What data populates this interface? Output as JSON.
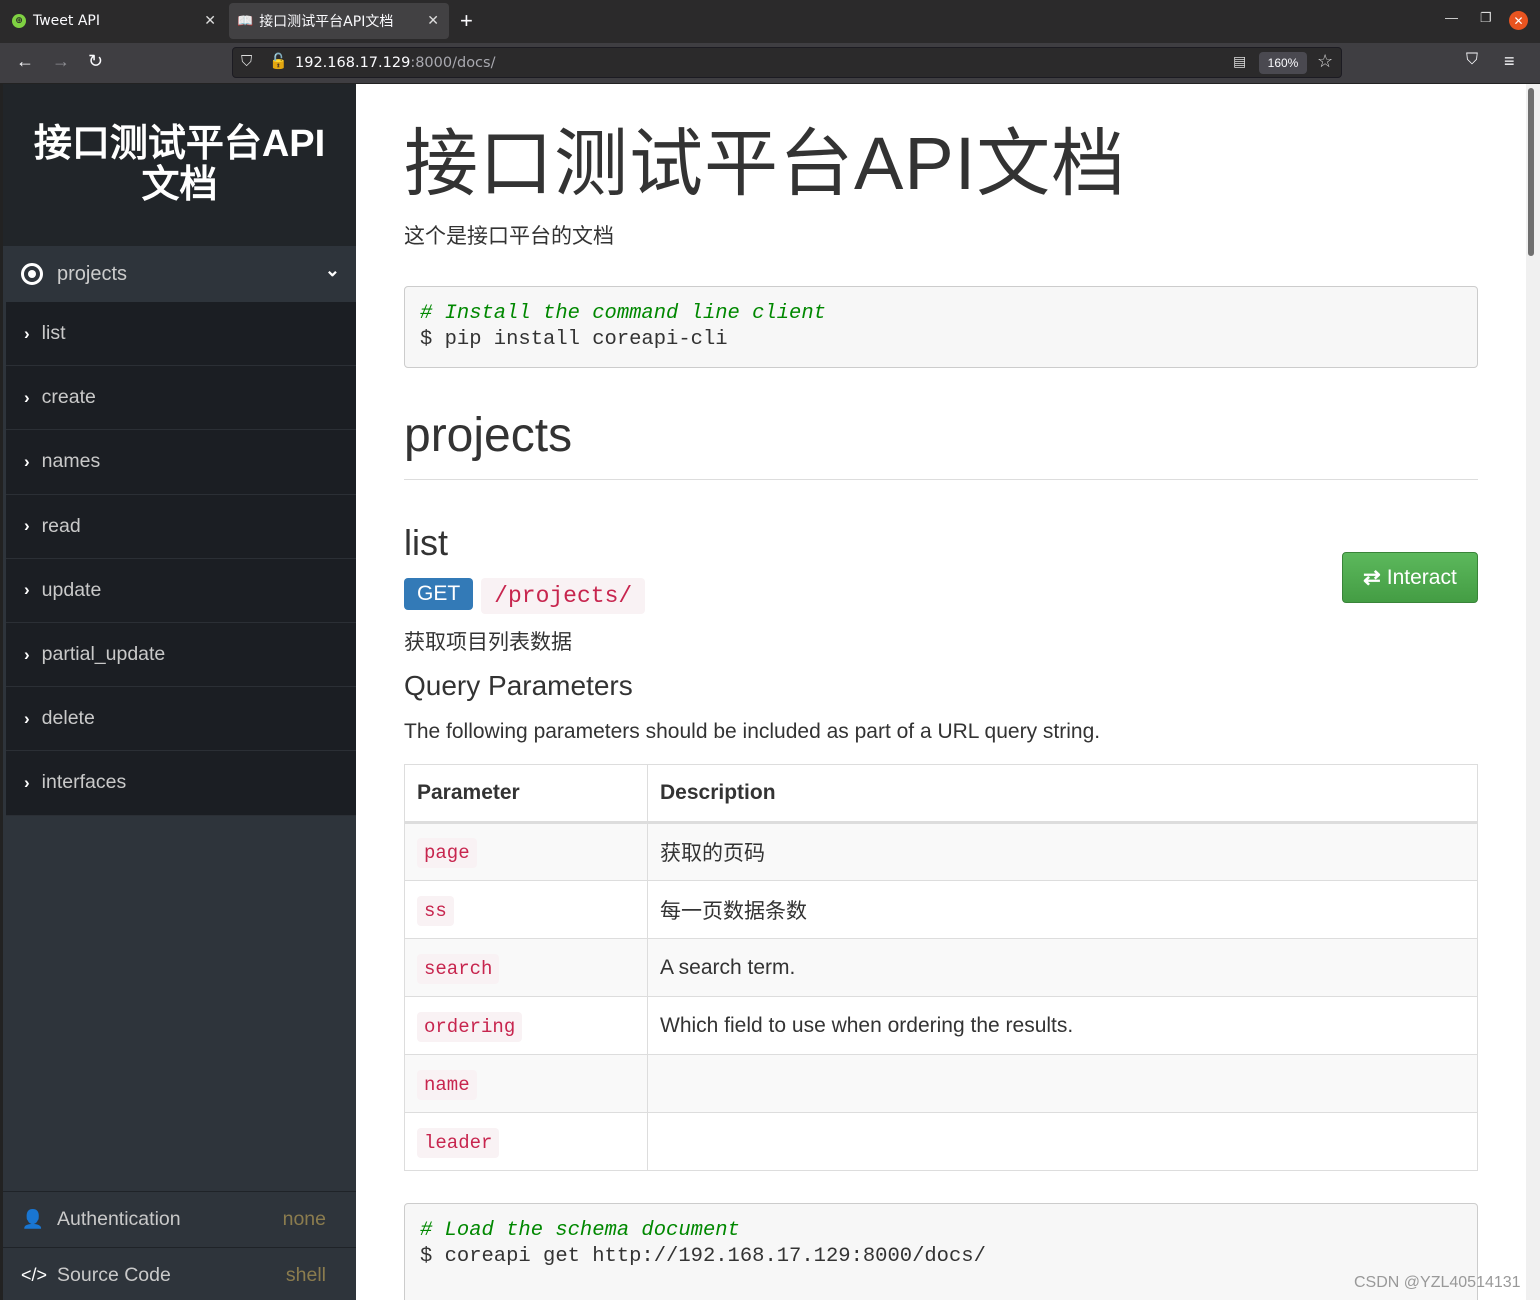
{
  "browser": {
    "tabs": [
      {
        "title": "Tweet API",
        "icon": "globe-icon",
        "active": false
      },
      {
        "title": "接口测试平台API文档",
        "icon": "reader-book-icon",
        "active": true
      }
    ],
    "url_host": "192.168.17.129",
    "url_rest": ":8000/docs/",
    "zoom_level": "160%"
  },
  "sidebar": {
    "title": "接口测试平台API文档",
    "group": {
      "label": "projects",
      "icon": "target-icon",
      "expanded": true
    },
    "items": [
      {
        "label": "list"
      },
      {
        "label": "create"
      },
      {
        "label": "names"
      },
      {
        "label": "read"
      },
      {
        "label": "update"
      },
      {
        "label": "partial_update"
      },
      {
        "label": "delete"
      },
      {
        "label": "interfaces"
      }
    ],
    "footer": [
      {
        "label": "Authentication",
        "value": "none",
        "icon": "user-icon"
      },
      {
        "label": "Source Code",
        "value": "shell",
        "icon": "code-icon"
      }
    ]
  },
  "main": {
    "title": "接口测试平台API文档",
    "subtitle": "这个是接口平台的文档",
    "install_code": {
      "comment": "# Install the command line client",
      "command": "$ pip install coreapi-cli"
    },
    "section_title": "projects",
    "endpoint": {
      "name": "list",
      "method": "GET",
      "path": "/projects/",
      "interact_label": "Interact",
      "description": "获取项目列表数据",
      "query_title": "Query Parameters",
      "query_desc": "The following parameters should be included as part of a URL query string.",
      "table": {
        "headers": [
          "Parameter",
          "Description"
        ],
        "rows": [
          {
            "param": "page",
            "desc": "获取的页码"
          },
          {
            "param": "ss",
            "desc": "每一页数据条数"
          },
          {
            "param": "search",
            "desc": "A search term."
          },
          {
            "param": "ordering",
            "desc": "Which field to use when ordering the results."
          },
          {
            "param": "name",
            "desc": ""
          },
          {
            "param": "leader",
            "desc": ""
          }
        ]
      },
      "schema_code": {
        "comment": "# Load the schema document",
        "command": "$ coreapi get http://192.168.17.129:8000/docs/"
      }
    }
  },
  "watermark": "CSDN @YZL40514131"
}
